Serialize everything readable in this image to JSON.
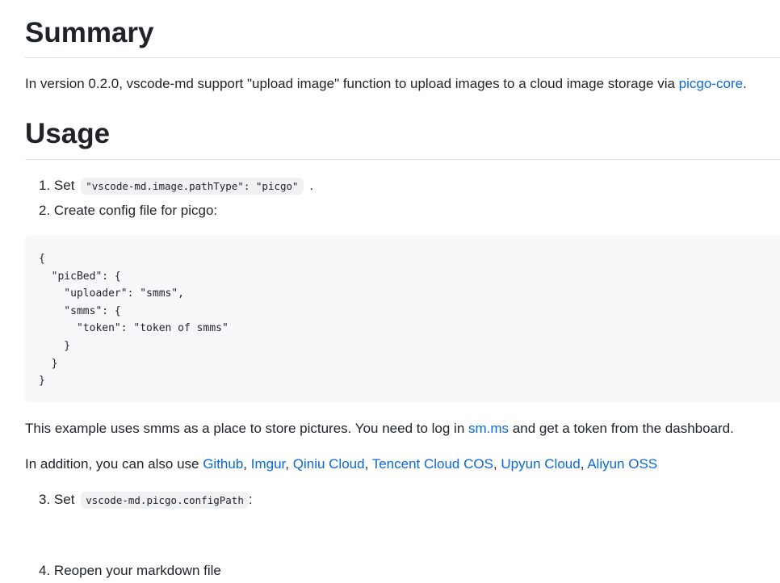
{
  "summary": {
    "heading": "Summary",
    "text_before": "In version 0.2.0, vscode-md support \"upload image\" function to upload images to a cloud image storage via ",
    "link": "picgo-core",
    "text_after": "."
  },
  "usage": {
    "heading": "Usage",
    "step1": {
      "number": "1.",
      "prefix": "Set",
      "code": "\"vscode-md.image.pathType\": \"picgo\"",
      "suffix": "."
    },
    "step2": {
      "number": "2.",
      "text": "Create config file for picgo:"
    },
    "config_code": "{\n  \"picBed\": {\n    \"uploader\": \"smms\",\n    \"smms\": {\n      \"token\": \"token of smms\"\n    }\n  }\n}",
    "example_para": {
      "text_before": "This example uses smms as a place to store pictures. You need to log in ",
      "link": "sm.ms",
      "text_after": " and get a token from the dashboard."
    },
    "addition_para": {
      "text_before": "In addition, you can also use ",
      "links": [
        "Github",
        "Imgur",
        "Qiniu Cloud",
        "Tencent Cloud COS",
        "Upyun Cloud",
        "Aliyun OSS"
      ],
      "separator": ", "
    },
    "step3": {
      "number": "3.",
      "prefix": "Set",
      "code": "vscode-md.picgo.configPath",
      "suffix": ":"
    },
    "step4": {
      "number": "4.",
      "text": "Reopen your markdown file"
    }
  }
}
